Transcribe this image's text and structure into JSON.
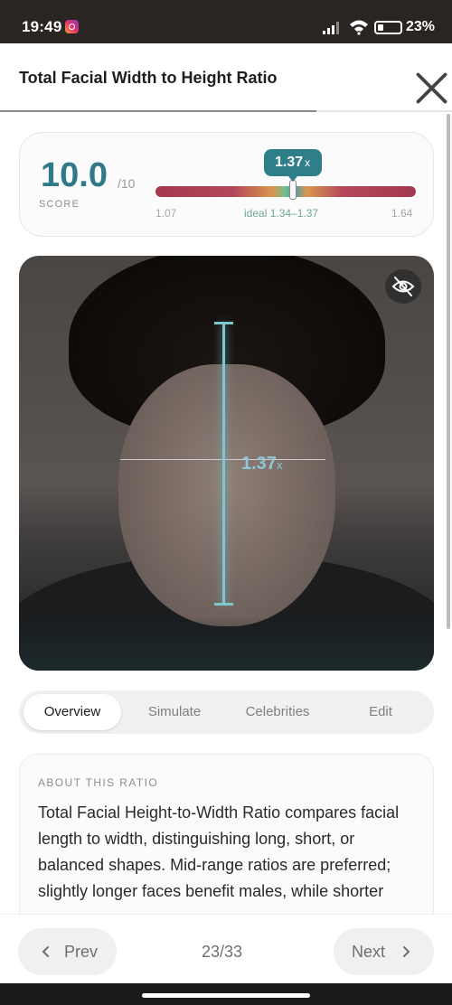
{
  "status_bar": {
    "time": "19:49",
    "battery": "23%"
  },
  "header": {
    "title": "Total Facial Width to Height Ratio",
    "progress_fraction": 0.7
  },
  "score": {
    "value": "10.0",
    "denominator": "/10",
    "label": "SCORE",
    "current": "1.37",
    "current_suffix": "x",
    "current_value": 1.37,
    "min": "1.07",
    "max": "1.64",
    "min_value": 1.07,
    "max_value": 1.64,
    "ideal": "ideal 1.34–1.37",
    "gauge_colors": {
      "ends": "#a3394f",
      "ideal": "#3a9fb8"
    }
  },
  "photo": {
    "ratio": "1.37",
    "ratio_suffix": "x"
  },
  "tabs": [
    {
      "label": "Overview",
      "active": true
    },
    {
      "label": "Simulate",
      "active": false
    },
    {
      "label": "Celebrities",
      "active": false
    },
    {
      "label": "Edit",
      "active": false
    }
  ],
  "about": {
    "heading": "ABOUT THIS RATIO",
    "text": "Total Facial Height-to-Width Ratio compares facial length to width, distinguishing long, short, or balanced shapes. Mid-range ratios are preferred; slightly longer faces benefit males, while shorter"
  },
  "footer": {
    "prev": "Prev",
    "next": "Next",
    "page": "23/33"
  },
  "colors": {
    "accent": "#2f7f8b",
    "score": "#2f7a86"
  },
  "icons": {
    "close": "close-icon",
    "hide": "eye-off-icon",
    "prev": "chevron-left-icon",
    "next": "chevron-right-icon"
  }
}
